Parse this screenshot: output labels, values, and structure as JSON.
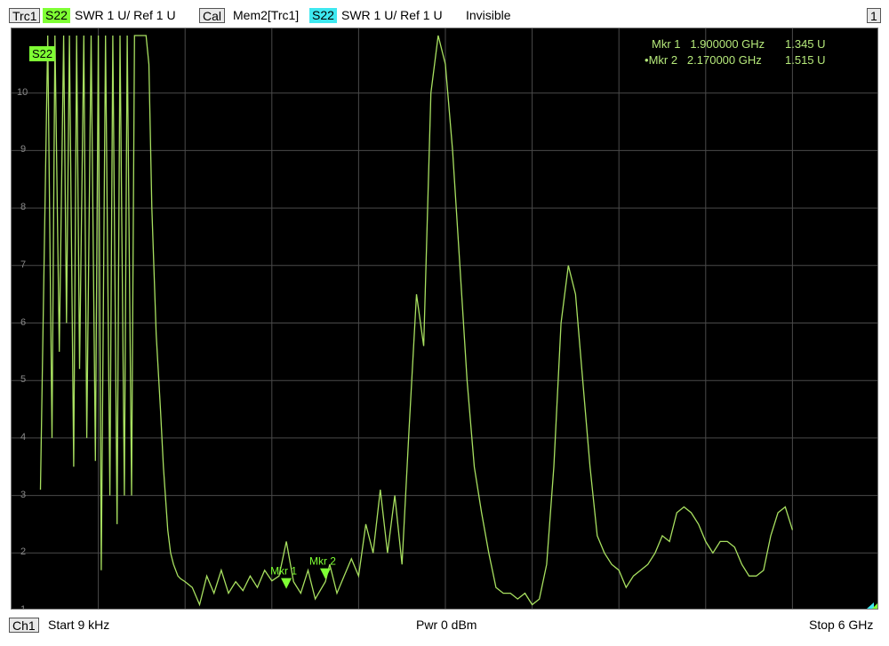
{
  "top_bar": {
    "trace_label": "Trc1",
    "trace_param": "S22",
    "trace_format": "SWR  1 U/  Ref 1 U",
    "trace_cal": "Cal",
    "mem_label": "Mem2[Trc1]",
    "mem_param": "S22",
    "mem_format": "SWR  1 U/  Ref 1 U",
    "mem_state": "Invisible",
    "window_number": "1"
  },
  "plot": {
    "trace_badge": "S22",
    "y_ticks": [
      "10",
      "9",
      "8",
      "7",
      "6",
      "5",
      "4",
      "3",
      "2",
      "1"
    ],
    "trace_color": "#a8e060",
    "grid_color": "#4a4a4a"
  },
  "markers": {
    "mkr1": {
      "name": "Mkr 1",
      "freq": "1.900000 GHz",
      "value": "1.345 U"
    },
    "mkr2": {
      "name": "Mkr 2",
      "freq": "2.170000 GHz",
      "value": "1.515 U",
      "prefix": "•"
    },
    "mkr1_label": "Mkr 1",
    "mkr2_label": "Mkr 2"
  },
  "bottom_bar": {
    "channel": "Ch1",
    "start": "Start  9 kHz",
    "power": "Pwr  0 dBm",
    "stop": "Stop  6 GHz"
  },
  "chart_data": {
    "type": "line",
    "x_range_ghz": [
      9e-06,
      6
    ],
    "ylim": [
      1,
      11
    ],
    "series": [
      {
        "x_ghz": [
          0.2,
          0.25,
          0.28,
          0.3,
          0.33,
          0.36,
          0.38,
          0.4,
          0.43,
          0.45,
          0.47,
          0.5,
          0.52,
          0.55,
          0.58,
          0.6,
          0.62,
          0.65,
          0.68,
          0.7,
          0.73,
          0.75,
          0.78,
          0.8,
          0.83,
          0.85,
          0.88,
          0.9,
          0.93,
          0.95,
          0.97,
          1.0,
          1.03,
          1.05,
          1.08,
          1.1,
          1.12,
          1.15,
          1.17,
          1.2,
          1.25,
          1.3,
          1.35,
          1.4,
          1.45,
          1.5,
          1.55,
          1.6,
          1.65,
          1.7,
          1.75,
          1.8,
          1.85,
          1.9,
          1.95,
          2.0,
          2.05,
          2.1,
          2.17,
          2.2,
          2.25,
          2.3,
          2.35,
          2.4,
          2.45,
          2.5,
          2.55,
          2.6,
          2.65,
          2.7,
          2.75,
          2.8,
          2.85,
          2.9,
          2.95,
          3.0,
          3.05,
          3.1,
          3.15,
          3.2,
          3.25,
          3.3,
          3.35,
          3.4,
          3.45,
          3.5,
          3.55,
          3.6,
          3.65,
          3.7,
          3.75,
          3.8,
          3.85,
          3.9,
          3.95,
          4.0,
          4.05,
          4.1,
          4.15,
          4.2,
          4.25,
          4.3,
          4.35,
          4.4,
          4.45,
          4.5,
          4.55,
          4.6,
          4.65,
          4.7,
          4.75,
          4.8,
          4.85,
          4.9,
          4.95,
          5.0,
          5.05,
          5.1,
          5.15,
          5.2,
          5.25,
          5.3,
          5.35,
          5.4,
          5.45,
          5.5,
          5.55,
          5.6,
          5.65,
          5.7,
          5.75,
          5.8,
          5.85,
          5.9,
          5.95,
          6.0
        ],
        "values": [
          3.1,
          11,
          4.0,
          11,
          5.5,
          11,
          6.0,
          11,
          3.5,
          11,
          5.2,
          11,
          4.0,
          11,
          3.6,
          11,
          1.7,
          11,
          3.0,
          11,
          2.5,
          11,
          3.0,
          11,
          3.0,
          11,
          11,
          11,
          11,
          10.5,
          8.0,
          5.8,
          4.5,
          3.5,
          2.4,
          2.0,
          1.8,
          1.6,
          1.55,
          1.5,
          1.4,
          1.1,
          1.6,
          1.3,
          1.7,
          1.3,
          1.5,
          1.345,
          1.6,
          1.4,
          1.7,
          1.515,
          1.6,
          2.2,
          1.5,
          1.3,
          1.7,
          1.2,
          1.5,
          1.8,
          1.3,
          1.6,
          1.9,
          1.6,
          2.5,
          2.0,
          3.1,
          2.0,
          3.0,
          1.8,
          4.2,
          6.5,
          5.6,
          10.0,
          11.0,
          10.5,
          9.0,
          7.0,
          5.0,
          3.5,
          2.7,
          2.0,
          1.4,
          1.3,
          1.3,
          1.2,
          1.3,
          1.1,
          1.2,
          1.8,
          3.5,
          6.0,
          7.0,
          6.5,
          5.0,
          3.5,
          2.3,
          2.0,
          1.8,
          1.7,
          1.4,
          1.6,
          1.7,
          1.8,
          2.0,
          2.3,
          2.2,
          2.7,
          2.8,
          2.7,
          2.5,
          2.2,
          2.0,
          2.2,
          2.2,
          2.1,
          1.8,
          1.6,
          1.6,
          1.7,
          2.3,
          2.7,
          2.8,
          2.4
        ]
      }
    ]
  }
}
